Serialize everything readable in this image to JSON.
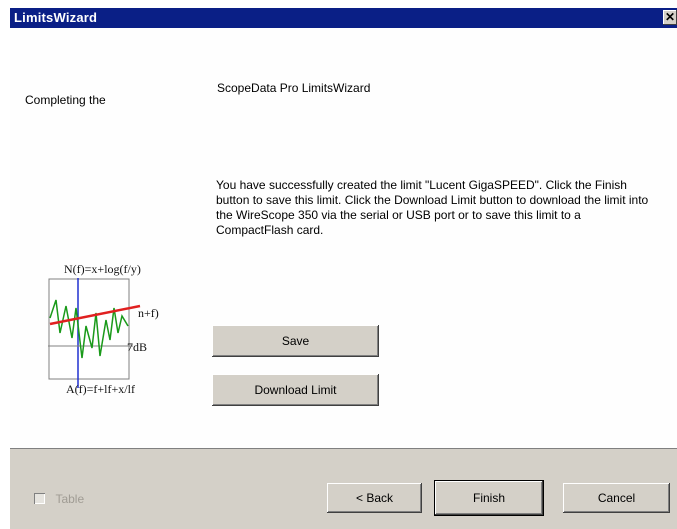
{
  "window": {
    "title": "LimitsWizard",
    "close_glyph": "✕"
  },
  "content": {
    "heading_left": "Completing the",
    "heading_right": "ScopeData Pro LimitsWizard",
    "message": "You have successfully created the limit \"Lucent GigaSPEED\". Click the Finish button to save this limit.  Click the Download Limit button to download the limit into the WireScope 350 via the serial or USB port or to save this limit to a CompactFlash card."
  },
  "graphic": {
    "formula_top": "N(f)=x+log(f/y)",
    "formula_right_top": "n+f)",
    "formula_right_bottom": "7dB",
    "formula_bottom": "A(f)=f+lf+x/lf",
    "icon_name": "limit-graph-icon",
    "colors": {
      "limit_line": "#e02020",
      "signal": "#1a9a1a",
      "axis": "#2030d0"
    }
  },
  "buttons": {
    "save": "Save",
    "download": "Download Limit",
    "back": "< Back",
    "finish": "Finish",
    "cancel": "Cancel"
  },
  "footer": {
    "checkbox_label": "Table"
  }
}
